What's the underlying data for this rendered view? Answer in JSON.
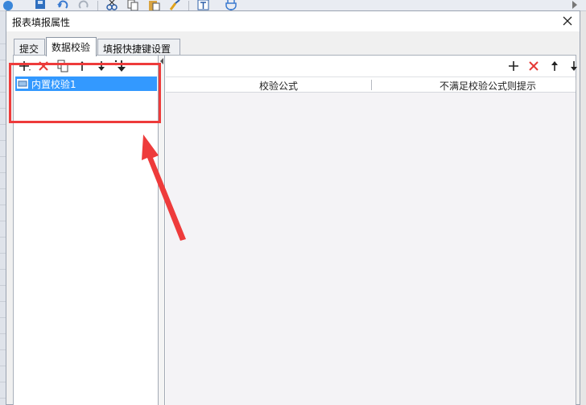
{
  "dialog": {
    "title": "报表填报属性"
  },
  "tabs": [
    {
      "label": "提交",
      "active": false
    },
    {
      "label": "数据校验",
      "active": true
    },
    {
      "label": "填报快捷键设置",
      "active": false
    }
  ],
  "left_panel": {
    "toolbar_icons": [
      "add-icon",
      "delete-icon",
      "copy-icon",
      "move-up-icon",
      "move-down-icon",
      "move-bottom-icon"
    ],
    "items": [
      {
        "label": "内置校验1",
        "selected": true
      }
    ]
  },
  "right_panel": {
    "toolbar_icons": [
      "add-icon",
      "delete-icon",
      "move-up-icon",
      "move-down-icon"
    ],
    "columns": [
      "校验公式",
      "不满足校验公式则提示"
    ]
  },
  "colors": {
    "selection": "#3399ff",
    "annotation": "#ee3b3b",
    "delete": "#e53935"
  }
}
